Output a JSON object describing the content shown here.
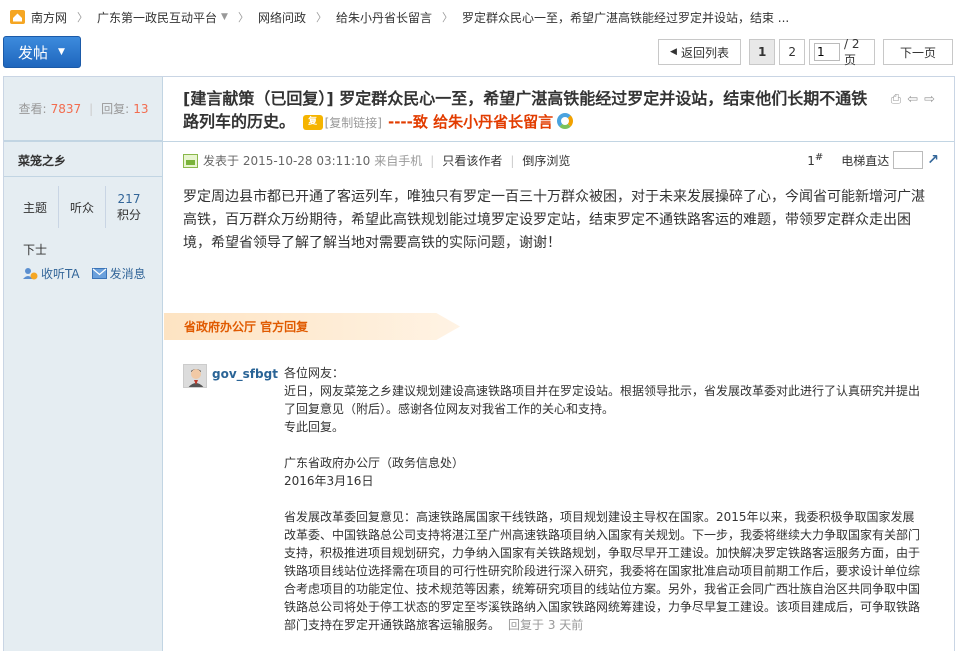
{
  "breadcrumb": {
    "items": [
      "南方网",
      "广东第一政民互动平台",
      "网络问政",
      "给朱小丹省长留言",
      "罗定群众民心一至，希望广湛高铁能经过罗定并设站，结束 ..."
    ]
  },
  "toolbar": {
    "post_label": "发帖",
    "back_label": "返回列表",
    "pages": [
      "1",
      "2"
    ],
    "page_input": "1",
    "page_total": "/ 2 页",
    "next_label": "下一页"
  },
  "stats": {
    "views_label": "查看:",
    "views": "7837",
    "replies_label": "回复:",
    "replies": "13"
  },
  "thread": {
    "title": "[建言献策（已回复）] 罗定群众民心一至，希望广湛高铁能经过罗定并设站，结束他们长期不通铁路列车的历史。",
    "copy_link": "[复制链接]",
    "to_line": "----致 给朱小丹省长留言"
  },
  "author": {
    "name": "菜笼之乡",
    "stats": [
      {
        "label": "主题",
        "value": ""
      },
      {
        "label": "听众",
        "value": ""
      },
      {
        "label": "积分",
        "value": "217"
      }
    ],
    "rank": "下士",
    "follow_label": "收听TA",
    "message_label": "发消息"
  },
  "post": {
    "posted_at": "发表于 2015-10-28 03:11:10",
    "from": "来自手机",
    "only_author": "只看该作者",
    "reverse": "倒序浏览",
    "floor_no": "1",
    "floor_sup": "#",
    "elevator": "电梯直达",
    "body": "罗定周边县市都已开通了客运列车，唯独只有罗定一百三十万群众被困，对于未来发展操碎了心，今闻省可能新增河广湛高铁，百万群众万纷期待，希望此高铁规划能过境罗定设罗定站，结束罗定不通铁路客运的难题，带领罗定群众走出困境，希望省领导了解了解当地对需要高铁的实际问题，谢谢！"
  },
  "official_reply": {
    "banner": "省政府办公厅 官方回复",
    "user": "gov_sfbgt",
    "greeting": "各位网友：",
    "lines": [
      "近日，网友菜笼之乡建议规划建设高速铁路项目并在罗定设站。根据领导批示，省发展改革委对此进行了认真研究并提出了回复意见（附后）。感谢各位网友对我省工作的关心和支持。",
      "专此回复。"
    ],
    "signature": "广东省政府办公厅（政务信息处）",
    "date": "2016年3月16日",
    "detail": "省发展改革委回复意见：高速铁路属国家干线铁路，项目规划建设主导权在国家。2015年以来，我委积极争取国家发展改革委、中国铁路总公司支持将湛江至广州高速铁路项目纳入国家有关规划。下一步，我委将继续大力争取国家有关部门支持，积极推进项目规划研究，力争纳入国家有关铁路规划，争取尽早开工建设。加快解决罗定铁路客运服务方面，由于铁路项目线站位选择需在项目的可行性研究阶段进行深入研究，我委将在国家批准启动项目前期工作后，要求设计单位综合考虑项目的功能定位、技术规范等因素，统筹研究项目的线站位方案。另外，我省正会同广西壮族自治区共同争取中国铁路总公司将处于停工状态的罗定至岑溪铁路纳入国家铁路网统筹建设，力争尽早复工建设。该项目建成后，可争取铁路部门支持在罗定开通铁路旅客运输服务。",
    "reply_time": "回复于 3 天前"
  },
  "colors": {
    "accent_blue": "#2a6ec4",
    "sidebar_bg": "#e5edf2",
    "count_orange": "#f26c4f",
    "banner_orange": "#e05a00"
  }
}
